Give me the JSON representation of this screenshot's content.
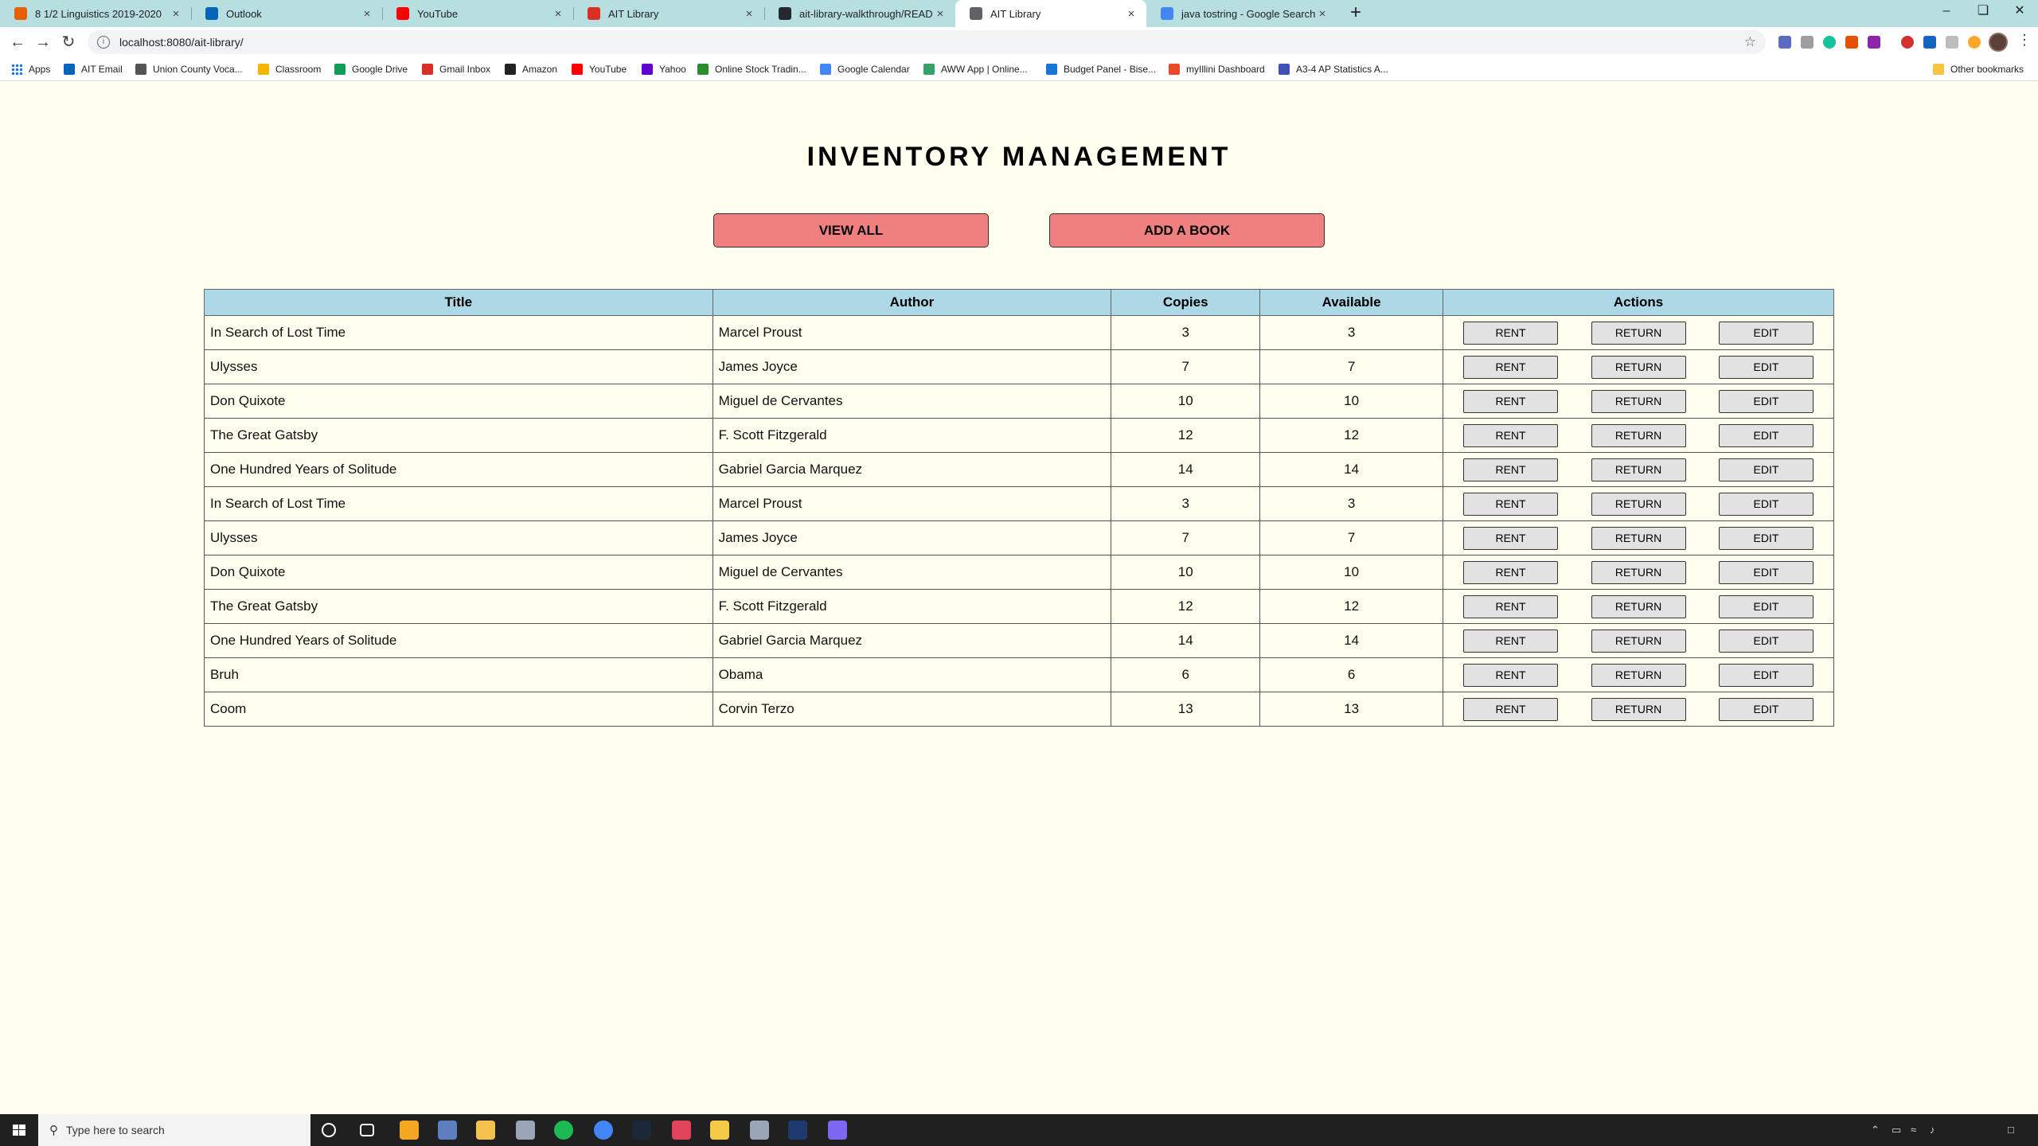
{
  "browser": {
    "tabs": [
      {
        "title": "8 1/2 Linguistics 2019-2020",
        "icon": "canvas-icon",
        "color": "#e66000",
        "active": false
      },
      {
        "title": "Outlook",
        "icon": "outlook-icon",
        "color": "#0364b8",
        "active": false
      },
      {
        "title": "YouTube",
        "icon": "youtube-icon",
        "color": "#ff0000",
        "active": false
      },
      {
        "title": "AIT Library",
        "icon": "loading-icon",
        "color": "#d93025",
        "active": false
      },
      {
        "title": "ait-library-walkthrough/README...",
        "icon": "github-icon",
        "color": "#24292e",
        "active": false
      },
      {
        "title": "AIT Library",
        "icon": "globe-icon",
        "color": "#5f6368",
        "active": true
      },
      {
        "title": "java tostring - Google Search",
        "icon": "google-icon",
        "color": "#4285f4",
        "active": false
      }
    ],
    "url": "localhost:8080/ait-library/",
    "bookmarks": [
      {
        "label": "Apps",
        "icon": "apps-grid-icon",
        "color": "#1a73e8"
      },
      {
        "label": "AIT Email",
        "icon": "outlook-icon",
        "color": "#0364b8"
      },
      {
        "label": "Union County Voca...",
        "icon": "school-icon",
        "color": "#555555"
      },
      {
        "label": "Classroom",
        "icon": "classroom-icon",
        "color": "#f4b400"
      },
      {
        "label": "Google Drive",
        "icon": "drive-icon",
        "color": "#0f9d58"
      },
      {
        "label": "Gmail Inbox",
        "icon": "gmail-icon",
        "color": "#d93025"
      },
      {
        "label": "Amazon",
        "icon": "amazon-icon",
        "color": "#222222"
      },
      {
        "label": "YouTube",
        "icon": "youtube-icon",
        "color": "#ff0000"
      },
      {
        "label": "Yahoo",
        "icon": "yahoo-icon",
        "color": "#6001d2"
      },
      {
        "label": "Online Stock Tradin...",
        "icon": "td-icon",
        "color": "#2a8c2a"
      },
      {
        "label": "Google Calendar",
        "icon": "calendar-icon",
        "color": "#4285f4"
      },
      {
        "label": "AWW App | Online...",
        "icon": "aww-icon",
        "color": "#38a169"
      },
      {
        "label": "Budget Panel - Bise...",
        "icon": "budget-icon",
        "color": "#1976d2"
      },
      {
        "label": "myIllini Dashboard",
        "icon": "illini-icon",
        "color": "#e84a27"
      },
      {
        "label": "A3-4 AP Statistics A...",
        "icon": "stats-icon",
        "color": "#3f51b5"
      }
    ],
    "other_bookmarks": "Other bookmarks"
  },
  "page": {
    "title": "INVENTORY MANAGEMENT",
    "view_all_label": "VIEW ALL",
    "add_book_label": "ADD A BOOK",
    "table": {
      "headers": [
        "Title",
        "Author",
        "Copies",
        "Available",
        "Actions"
      ],
      "action_labels": {
        "rent": "RENT",
        "return": "RETURN",
        "edit": "EDIT"
      },
      "rows": [
        {
          "title": "In Search of Lost Time",
          "author": "Marcel Proust",
          "copies": "3",
          "available": "3"
        },
        {
          "title": "Ulysses",
          "author": "James Joyce",
          "copies": "7",
          "available": "7"
        },
        {
          "title": "Don Quixote",
          "author": "Miguel de Cervantes",
          "copies": "10",
          "available": "10"
        },
        {
          "title": "The Great Gatsby",
          "author": "F. Scott Fitzgerald",
          "copies": "12",
          "available": "12"
        },
        {
          "title": "One Hundred Years of Solitude",
          "author": "Gabriel Garcia Marquez",
          "copies": "14",
          "available": "14"
        },
        {
          "title": "In Search of Lost Time",
          "author": "Marcel Proust",
          "copies": "3",
          "available": "3"
        },
        {
          "title": "Ulysses",
          "author": "James Joyce",
          "copies": "7",
          "available": "7"
        },
        {
          "title": "Don Quixote",
          "author": "Miguel de Cervantes",
          "copies": "10",
          "available": "10"
        },
        {
          "title": "The Great Gatsby",
          "author": "F. Scott Fitzgerald",
          "copies": "12",
          "available": "12"
        },
        {
          "title": "One Hundred Years of Solitude",
          "author": "Gabriel Garcia Marquez",
          "copies": "14",
          "available": "14"
        },
        {
          "title": "Bruh",
          "author": "Obama",
          "copies": "6",
          "available": "6"
        },
        {
          "title": "Coom",
          "author": "Corvin Terzo",
          "copies": "13",
          "available": "13"
        }
      ]
    },
    "colors": {
      "background": "#fffdee",
      "button": "#f08080",
      "table_header": "#add8e6"
    }
  },
  "taskbar": {
    "search_placeholder": "Type here to search",
    "apps": [
      {
        "icon": "cortana-icon",
        "color": "#202020"
      },
      {
        "icon": "task-view-icon",
        "color": "#202020"
      },
      {
        "icon": "app-icon-orange",
        "color": "#f5a623"
      },
      {
        "icon": "app-icon-blue",
        "color": "#5b7fbf"
      },
      {
        "icon": "file-explorer-icon",
        "color": "#f2c14e"
      },
      {
        "icon": "app-icon-grey",
        "color": "#9aa6b8"
      },
      {
        "icon": "spotify-icon",
        "color": "#1db954"
      },
      {
        "icon": "chrome-icon",
        "color": "#4285f4"
      },
      {
        "icon": "steam-icon",
        "color": "#1b2838"
      },
      {
        "icon": "app-icon-red",
        "color": "#e0445a"
      },
      {
        "icon": "app-icon-yellow",
        "color": "#f7c948"
      },
      {
        "icon": "app-icon-grey",
        "color": "#9aa6b8"
      },
      {
        "icon": "app-icon-navy",
        "color": "#1e3a6e"
      },
      {
        "icon": "app-icon-purple",
        "color": "#7b68ee"
      }
    ]
  }
}
